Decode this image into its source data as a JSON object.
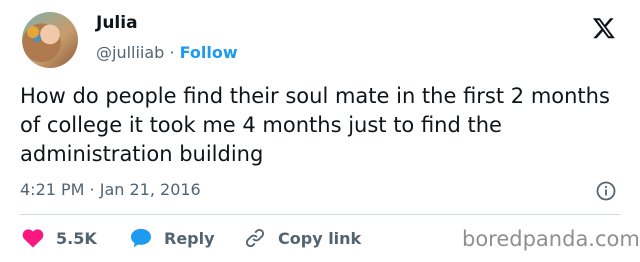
{
  "author": {
    "name": "Julia",
    "handle": "@julliiab",
    "separator": "·",
    "follow_label": "Follow"
  },
  "tweet": {
    "text": "How do people find their soul mate in the first 2 months of college it took me 4 months just to find the administration building",
    "timestamp": "4:21 PM · Jan 21, 2016"
  },
  "actions": {
    "likes": "5.5K",
    "reply_label": "Reply",
    "copy_link_label": "Copy link"
  },
  "watermark": "boredpanda.com",
  "icons": {
    "brand": "x-logo-icon",
    "like": "heart-icon",
    "reply": "speech-bubble-icon",
    "copy": "link-icon",
    "info": "info-icon"
  },
  "colors": {
    "accent": "#1d9bf0",
    "like": "#f91880",
    "text": "#0f1419",
    "muted": "#536471"
  }
}
